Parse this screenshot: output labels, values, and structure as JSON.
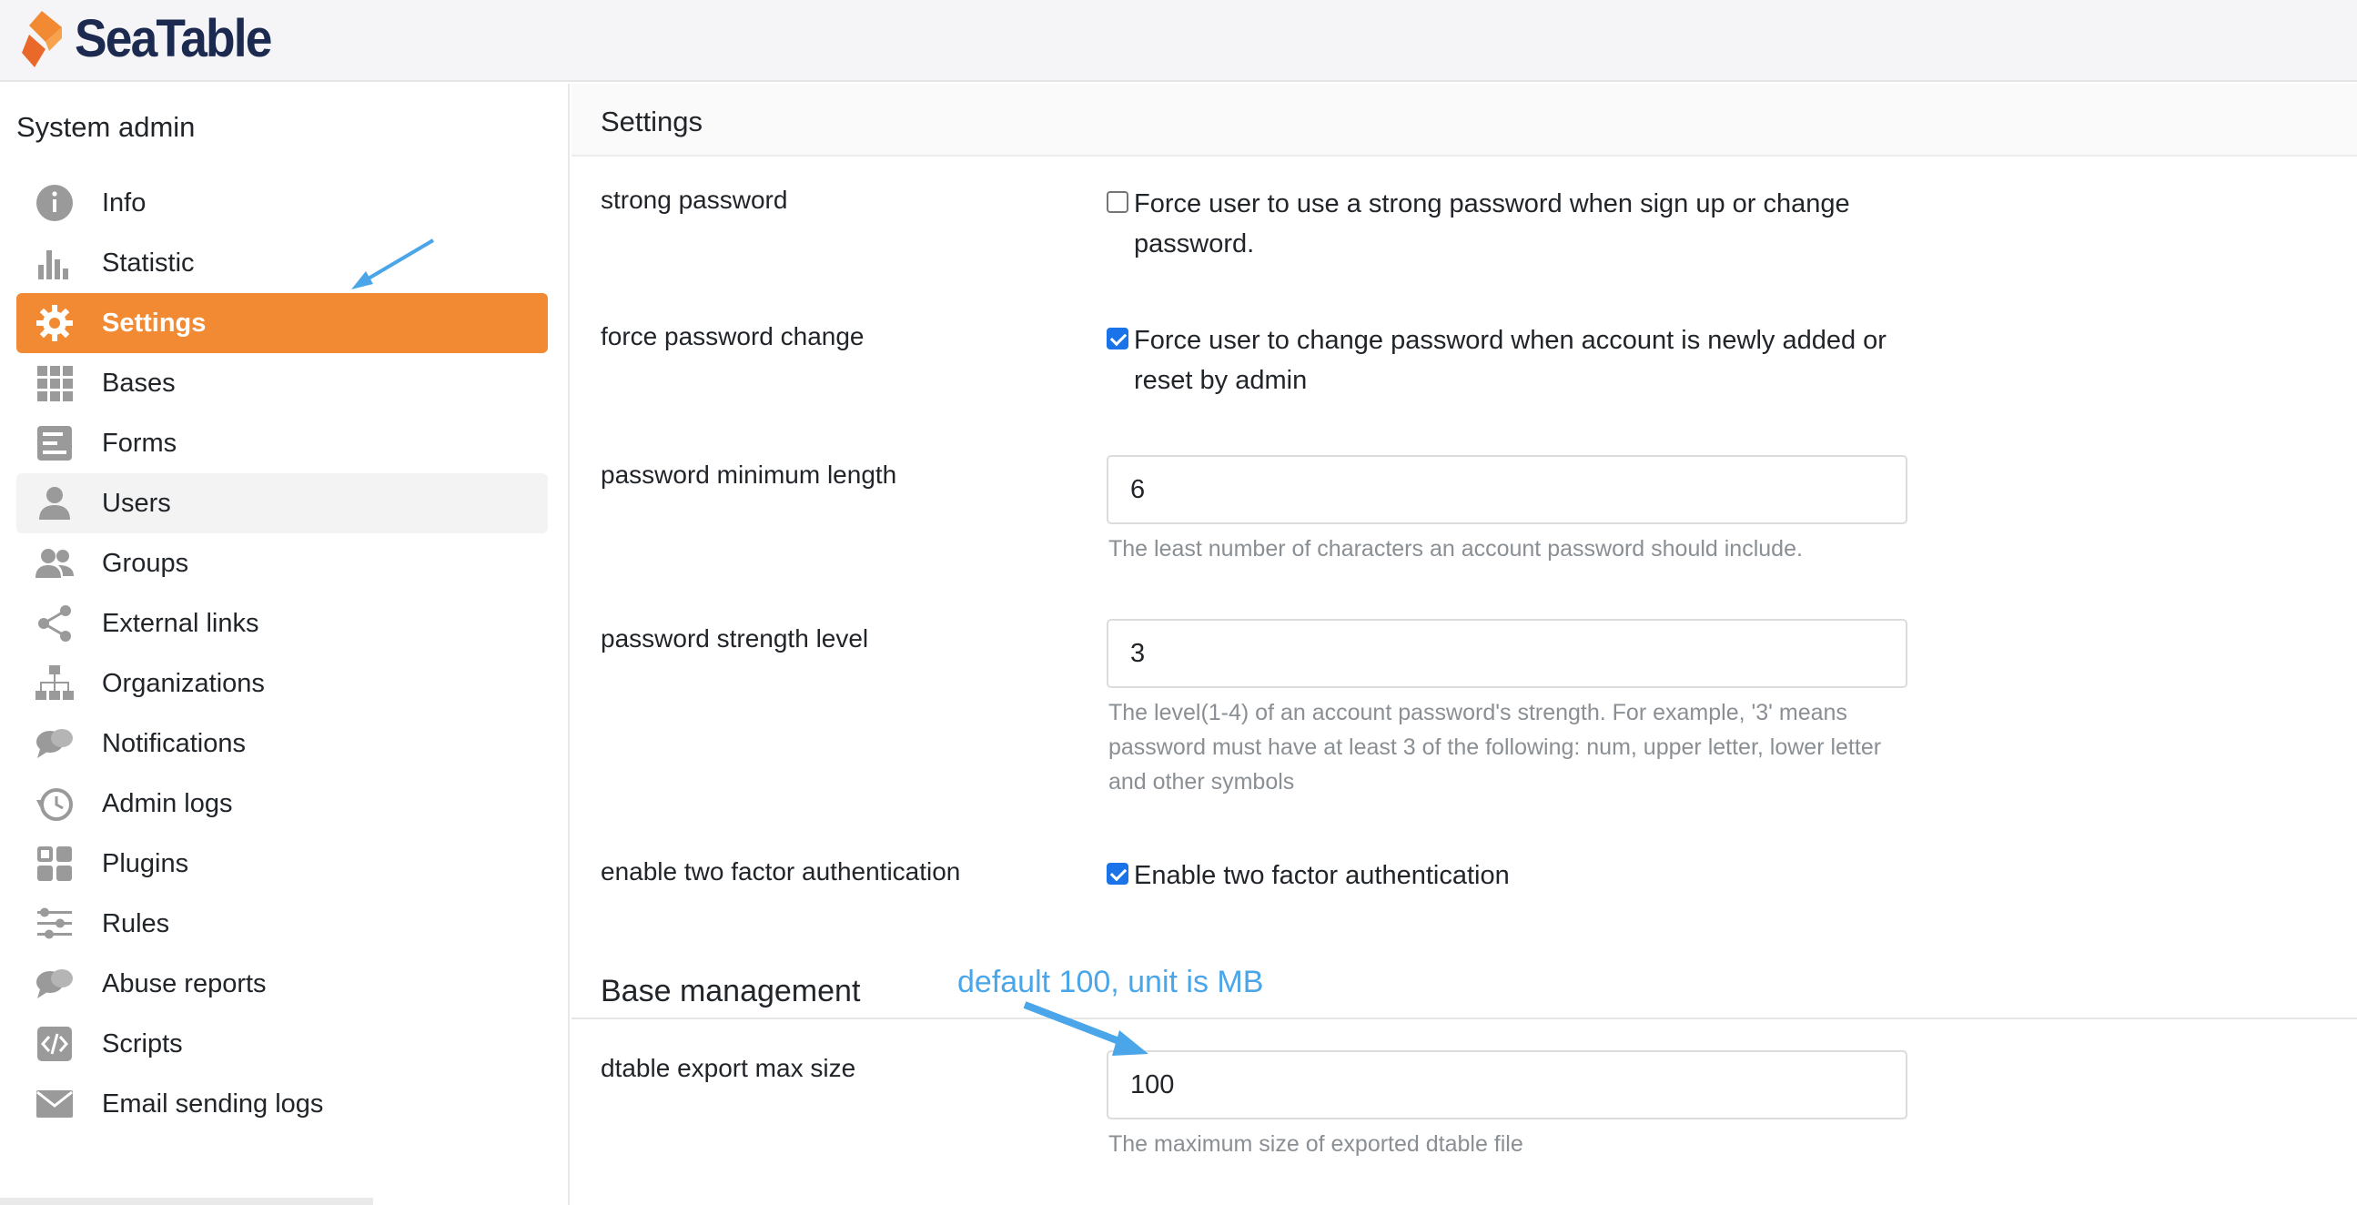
{
  "brand": {
    "name": "SeaTable",
    "accent": "#f28a33",
    "text_color": "#1b2a4e"
  },
  "sidebar": {
    "title": "System admin",
    "items": [
      {
        "label": "Info",
        "icon": "info-icon"
      },
      {
        "label": "Statistic",
        "icon": "bar-chart-icon"
      },
      {
        "label": "Settings",
        "icon": "gear-icon",
        "active": true
      },
      {
        "label": "Bases",
        "icon": "grid-icon"
      },
      {
        "label": "Forms",
        "icon": "form-icon"
      },
      {
        "label": "Users",
        "icon": "user-icon",
        "hover": true
      },
      {
        "label": "Groups",
        "icon": "group-icon"
      },
      {
        "label": "External links",
        "icon": "share-icon"
      },
      {
        "label": "Organizations",
        "icon": "org-chart-icon"
      },
      {
        "label": "Notifications",
        "icon": "chat-bubbles-icon"
      },
      {
        "label": "Admin logs",
        "icon": "history-icon"
      },
      {
        "label": "Plugins",
        "icon": "plugins-icon"
      },
      {
        "label": "Rules",
        "icon": "sliders-icon"
      },
      {
        "label": "Abuse reports",
        "icon": "chat-bubbles-icon"
      },
      {
        "label": "Scripts",
        "icon": "code-icon"
      },
      {
        "label": "Email sending logs",
        "icon": "envelope-icon"
      }
    ]
  },
  "main": {
    "title": "Settings",
    "settings": {
      "strong_password": {
        "label": "strong password",
        "text": "Force user to use a strong password when sign up or change password.",
        "checked": false
      },
      "force_password_change": {
        "label": "force password change",
        "text": "Force user to change password when account is newly added or reset by admin",
        "checked": true
      },
      "password_min_length": {
        "label": "password minimum length",
        "value": "6",
        "help": "The least number of characters an account password should include."
      },
      "password_strength_level": {
        "label": "password strength level",
        "value": "3",
        "help": "The level(1-4) of an account password's strength. For example, '3' means password must have at least 3 of the following: num, upper letter, lower letter and other symbols"
      },
      "two_factor": {
        "label": "enable two factor authentication",
        "text": "Enable two factor authentication",
        "checked": true
      }
    },
    "base_management": {
      "title": "Base management",
      "dtable_export_max_size": {
        "label": "dtable export max size",
        "value": "100",
        "help": "The maximum size of exported dtable file"
      }
    }
  },
  "annotations": {
    "note": "default 100, unit is MB",
    "color": "#4aa6e8"
  },
  "colors": {
    "checkbox_checked": "#1a73e8",
    "icon_gray": "#9a9a9a"
  }
}
